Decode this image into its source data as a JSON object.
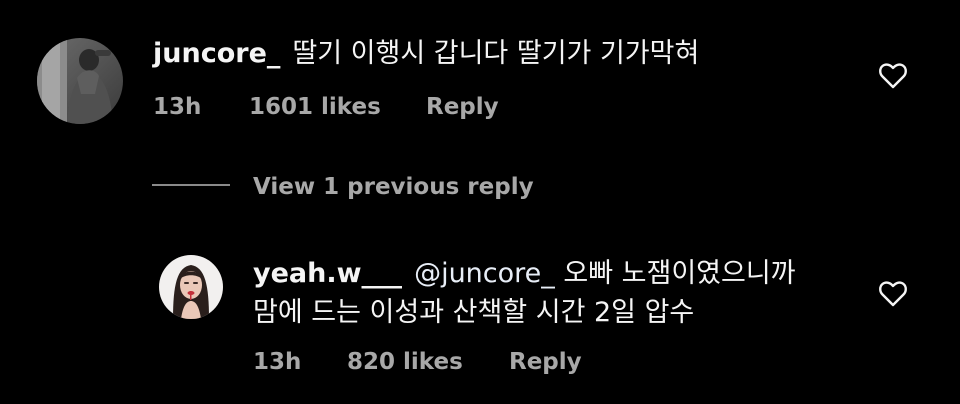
{
  "comments": [
    {
      "username": "juncore_",
      "text": "딸기 이행시 갑니다 딸기가 기가막혀",
      "time": "13h",
      "likes": "1601 likes",
      "reply_label": "Reply"
    },
    {
      "username": "yeah.w___",
      "mention": "@juncore_",
      "text_line1": "오빠 노잼이였으니까",
      "text_line2": "맘에 드는 이성과 산책할 시간 2일 압수",
      "time": "13h",
      "likes": "820 likes",
      "reply_label": "Reply"
    }
  ],
  "view_previous_replies": "View 1 previous reply",
  "colors": {
    "background": "#000000",
    "text": "#f5f5f5",
    "meta": "#a8a8a8"
  },
  "icons": {
    "like": "heart-outline-icon"
  }
}
